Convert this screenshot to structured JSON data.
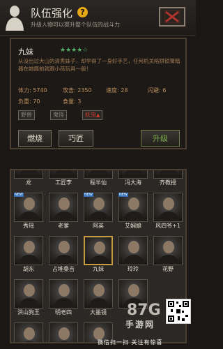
{
  "header": {
    "title": "队伍强化",
    "help": "?",
    "subtitle": "升级人物可以提升整个队伍的战斗力",
    "close": "✕"
  },
  "hero": {
    "name": "九妹",
    "stars": "★★★★☆",
    "description": "从没出过大山的清秀妹子，却学得了一身好手艺，任何机关陷阱锁簧暗器在她面前就跟小孩玩具一般！",
    "stats": {
      "hp": "体力: 5740",
      "attack": "攻击: 2350",
      "speed": "速度: 28",
      "dodge": "闪避: 6",
      "load": "负重: 70",
      "food": "食量: 3"
    },
    "tags": [
      "野兽",
      "鬼怪",
      "妖虫"
    ],
    "tag_arrow": "▲"
  },
  "actions": {
    "burn": "燃烧",
    "craftsman": "巧匠",
    "upgrade": "升级"
  },
  "roster": {
    "row0": [
      "龙",
      "工匠李",
      "程半仙",
      "冯大海",
      "齐教授"
    ],
    "row1": [
      "秀瑶",
      "老爹",
      "阿英",
      "艾娴娘",
      "风四爷+1"
    ],
    "row2": [
      "胡东",
      "占堆桑吉",
      "九妹",
      "玲玲",
      "花野"
    ],
    "row3": [
      "洪山狗王",
      "明老四",
      "大墨镜",
      "",
      ""
    ],
    "new_badge": "NEW"
  },
  "watermark": {
    "brand": "87G",
    "site": "手游网",
    "scan": "微信扫一扫  关注有惊喜"
  }
}
